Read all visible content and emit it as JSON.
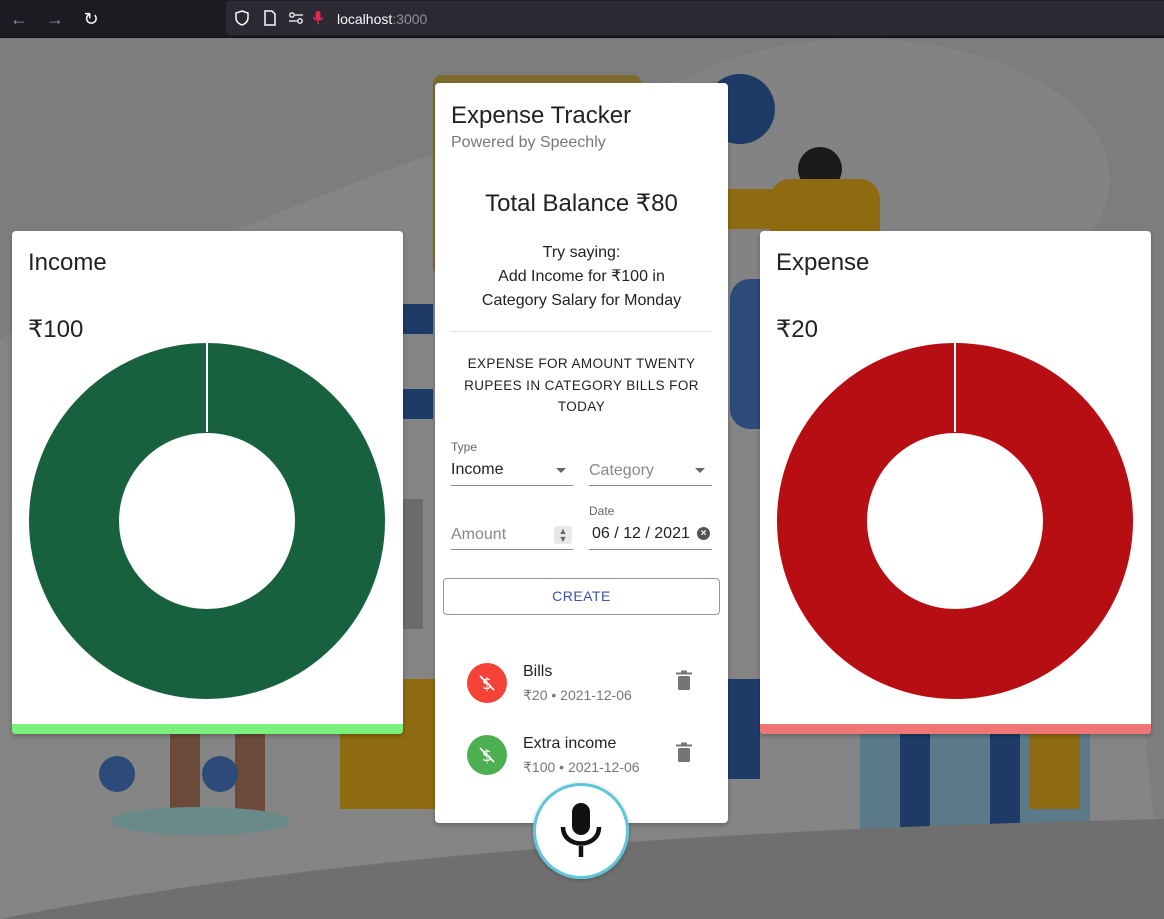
{
  "browser": {
    "url_host": "localhost",
    "url_port": ":3000"
  },
  "income": {
    "title": "Income",
    "amount": "₹100",
    "color": "#18613f",
    "bar_color": "#7cf07c",
    "share": 1
  },
  "expense": {
    "title": "Expense",
    "amount": "₹20",
    "color": "#b60e13",
    "bar_color": "#f07575",
    "share": 1
  },
  "tracker": {
    "title": "Expense Tracker",
    "subtitle": "Powered by Speechly",
    "balance": "Total Balance ₹80",
    "try_line1": "Try saying:",
    "try_line2": "Add Income for ₹100 in",
    "try_line3": "Category Salary for Monday",
    "speech_text": "EXPENSE FOR AMOUNT TWENTY RUPEES IN CATEGORY BILLS FOR TODAY"
  },
  "form": {
    "type_label": "Type",
    "type_value": "Income",
    "category_placeholder": "Category",
    "amount_placeholder": "Amount",
    "date_label": "Date",
    "date_value": "06 / 12 / 2021",
    "create_label": "CREATE"
  },
  "transactions": [
    {
      "name": "Bills",
      "meta": "₹20 • 2021-12-06",
      "color": "#f44336"
    },
    {
      "name": "Extra income",
      "meta": "₹100 • 2021-12-06",
      "color": "#4caf50"
    }
  ]
}
